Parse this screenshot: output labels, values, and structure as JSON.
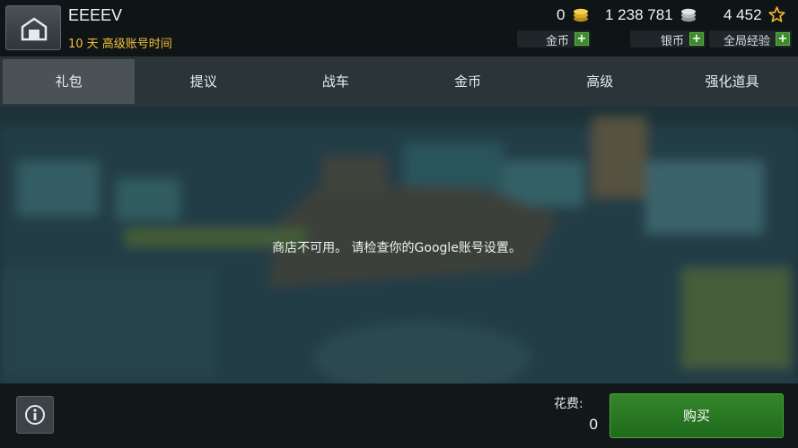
{
  "player": {
    "name": "EEEEV",
    "premium_time": "10 天 高级账号时间"
  },
  "currencies": {
    "gold": {
      "value": "0",
      "label": "金币",
      "icon": "gold-coins-icon",
      "add": "+"
    },
    "silver": {
      "value": "1 238 781",
      "label": "银币",
      "icon": "silver-coins-icon",
      "add": "+"
    },
    "xp": {
      "value": "4 452",
      "label": "全局经验",
      "icon": "star-icon",
      "add": "+"
    }
  },
  "tabs": [
    {
      "label": "礼包",
      "active": true
    },
    {
      "label": "提议"
    },
    {
      "label": "战车"
    },
    {
      "label": "金币"
    },
    {
      "label": "高级"
    },
    {
      "label": "强化道具"
    }
  ],
  "message": "商店不可用。 请检查你的Google账号设置。",
  "footer": {
    "cost_label": "花费:",
    "cost_value": "0",
    "buy_label": "购买",
    "info_icon": "info-icon"
  },
  "colors": {
    "accent_gold": "#f0c23a",
    "buy_green": "#2a7a24",
    "plus_green": "#3d8a2c"
  }
}
